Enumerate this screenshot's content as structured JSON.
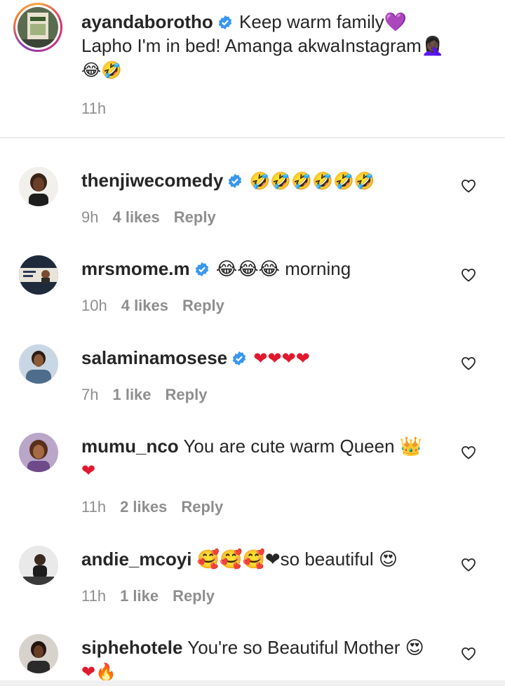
{
  "post": {
    "username": "ayandaborotho",
    "text_line1": "Keep warm family💜",
    "text_line2": "Lapho I'm in bed! Amanga akwaInstagram🤦🏿‍♀️",
    "text_line3": "😂🤣",
    "time": "11h"
  },
  "comments": [
    {
      "username": "thenjiwecomedy",
      "verified": true,
      "text": "🤣🤣🤣🤣🤣🤣",
      "text2": "",
      "time": "9h",
      "likes": "4 likes",
      "reply": "Reply"
    },
    {
      "username": "mrsmome.m",
      "verified": true,
      "text": "😂😂😂 morning",
      "text2": "",
      "time": "10h",
      "likes": "4 likes",
      "reply": "Reply"
    },
    {
      "username": "salaminamosese",
      "verified": true,
      "text": "❤❤❤❤",
      "text2": "",
      "time": "7h",
      "likes": "1 like",
      "reply": "Reply"
    },
    {
      "username": "mumu_nco",
      "verified": false,
      "text": "You are cute warm Queen 👑",
      "text2": "❤",
      "time": "11h",
      "likes": "2 likes",
      "reply": "Reply"
    },
    {
      "username": "andie_mcoyi",
      "verified": false,
      "text": "🥰🥰🥰❤so beautiful 😍",
      "text2": "",
      "time": "11h",
      "likes": "1 like",
      "reply": "Reply"
    },
    {
      "username": "siphehotele",
      "verified": false,
      "text": "You're so Beautiful Mother 😍",
      "text2": "❤🔥",
      "time": "",
      "likes": "",
      "reply": ""
    }
  ],
  "colors": {
    "verified": "#3897f0",
    "meta": "#8e8e8e",
    "heart": "#e0192f"
  }
}
